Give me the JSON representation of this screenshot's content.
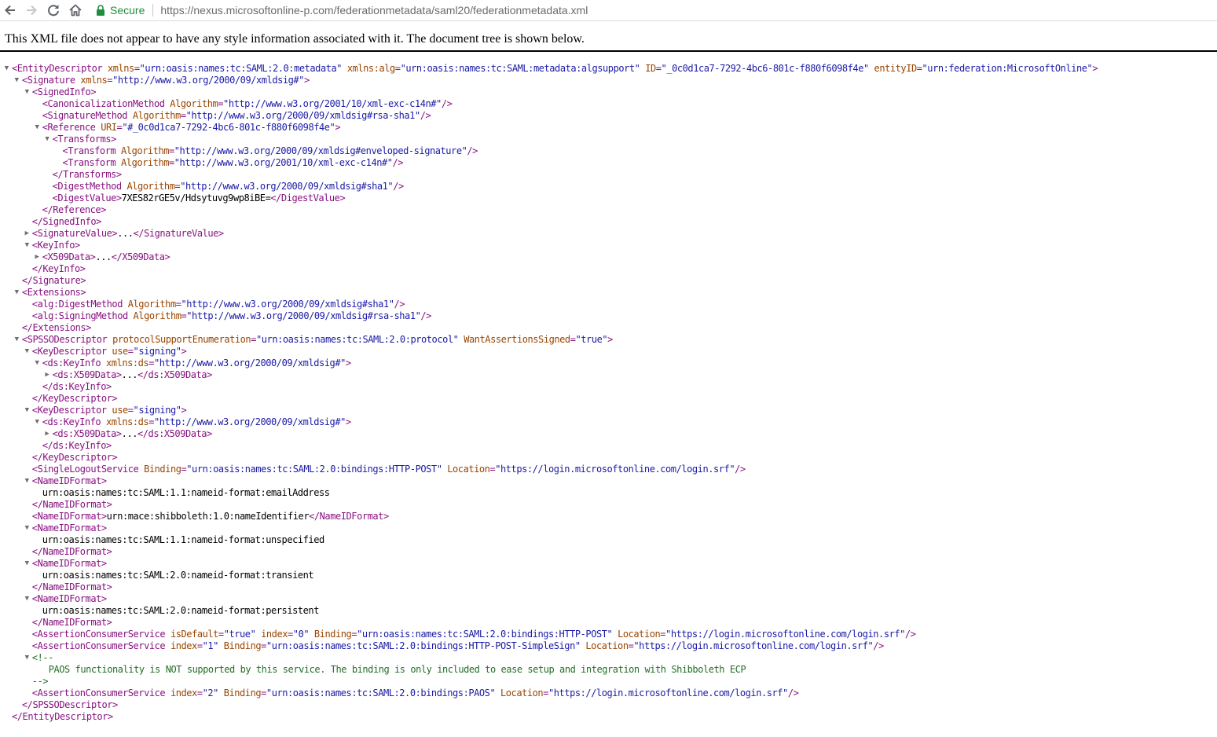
{
  "browser": {
    "secure_label": "Secure",
    "url_scheme": "https://",
    "url_host": "nexus.microsoftonline-p.com",
    "url_path": "/federationmetadata/saml20/federationmetadata.xml"
  },
  "viewer": {
    "info_text": "This XML file does not appear to have any style information associated with it. The document tree is shown below."
  },
  "xml_lines": [
    {
      "i": 0,
      "t": "open",
      "toggle": "expanded",
      "name": "EntityDescriptor",
      "attrs": [
        [
          "xmlns",
          "urn:oasis:names:tc:SAML:2.0:metadata"
        ],
        [
          "xmlns:alg",
          "urn:oasis:names:tc:SAML:metadata:algsupport"
        ],
        [
          "ID",
          "_0c0d1ca7-7292-4bc6-801c-f880f6098f4e"
        ],
        [
          "entityID",
          "urn:federation:MicrosoftOnline"
        ]
      ]
    },
    {
      "i": 1,
      "t": "open",
      "toggle": "expanded",
      "name": "Signature",
      "attrs": [
        [
          "xmlns",
          "http://www.w3.org/2000/09/xmldsig#"
        ]
      ]
    },
    {
      "i": 2,
      "t": "open",
      "toggle": "expanded",
      "name": "SignedInfo",
      "attrs": []
    },
    {
      "i": 3,
      "t": "self",
      "name": "CanonicalizationMethod",
      "attrs": [
        [
          "Algorithm",
          "http://www.w3.org/2001/10/xml-exc-c14n#"
        ]
      ]
    },
    {
      "i": 3,
      "t": "self",
      "name": "SignatureMethod",
      "attrs": [
        [
          "Algorithm",
          "http://www.w3.org/2000/09/xmldsig#rsa-sha1"
        ]
      ]
    },
    {
      "i": 3,
      "t": "open",
      "toggle": "expanded",
      "name": "Reference",
      "attrs": [
        [
          "URI",
          "#_0c0d1ca7-7292-4bc6-801c-f880f6098f4e"
        ]
      ]
    },
    {
      "i": 4,
      "t": "open",
      "toggle": "expanded",
      "name": "Transforms",
      "attrs": []
    },
    {
      "i": 5,
      "t": "self",
      "name": "Transform",
      "attrs": [
        [
          "Algorithm",
          "http://www.w3.org/2000/09/xmldsig#enveloped-signature"
        ]
      ]
    },
    {
      "i": 5,
      "t": "self",
      "name": "Transform",
      "attrs": [
        [
          "Algorithm",
          "http://www.w3.org/2001/10/xml-exc-c14n#"
        ]
      ]
    },
    {
      "i": 4,
      "t": "close",
      "name": "Transforms"
    },
    {
      "i": 4,
      "t": "self",
      "name": "DigestMethod",
      "attrs": [
        [
          "Algorithm",
          "http://www.w3.org/2000/09/xmldsig#sha1"
        ]
      ]
    },
    {
      "i": 4,
      "t": "inline",
      "name": "DigestValue",
      "attrs": [],
      "text": "7XES82rGE5v/Hdsytuvg9wp8iBE="
    },
    {
      "i": 3,
      "t": "close",
      "name": "Reference"
    },
    {
      "i": 2,
      "t": "close",
      "name": "SignedInfo"
    },
    {
      "i": 2,
      "t": "collapsed",
      "toggle": "collapsed",
      "name": "SignatureValue",
      "attrs": [],
      "text": "..."
    },
    {
      "i": 2,
      "t": "open",
      "toggle": "expanded",
      "name": "KeyInfo",
      "attrs": []
    },
    {
      "i": 3,
      "t": "collapsed",
      "toggle": "collapsed",
      "name": "X509Data",
      "attrs": [],
      "text": "..."
    },
    {
      "i": 2,
      "t": "close",
      "name": "KeyInfo"
    },
    {
      "i": 1,
      "t": "close",
      "name": "Signature"
    },
    {
      "i": 1,
      "t": "open",
      "toggle": "expanded",
      "name": "Extensions",
      "attrs": []
    },
    {
      "i": 2,
      "t": "self",
      "name": "alg:DigestMethod",
      "attrs": [
        [
          "Algorithm",
          "http://www.w3.org/2000/09/xmldsig#sha1"
        ]
      ]
    },
    {
      "i": 2,
      "t": "self",
      "name": "alg:SigningMethod",
      "attrs": [
        [
          "Algorithm",
          "http://www.w3.org/2000/09/xmldsig#rsa-sha1"
        ]
      ]
    },
    {
      "i": 1,
      "t": "close",
      "name": "Extensions"
    },
    {
      "i": 1,
      "t": "open",
      "toggle": "expanded",
      "name": "SPSSODescriptor",
      "attrs": [
        [
          "protocolSupportEnumeration",
          "urn:oasis:names:tc:SAML:2.0:protocol"
        ],
        [
          "WantAssertionsSigned",
          "true"
        ]
      ]
    },
    {
      "i": 2,
      "t": "open",
      "toggle": "expanded",
      "name": "KeyDescriptor",
      "attrs": [
        [
          "use",
          "signing"
        ]
      ]
    },
    {
      "i": 3,
      "t": "open",
      "toggle": "expanded",
      "name": "ds:KeyInfo",
      "attrs": [
        [
          "xmlns:ds",
          "http://www.w3.org/2000/09/xmldsig#"
        ]
      ]
    },
    {
      "i": 4,
      "t": "collapsed",
      "toggle": "collapsed",
      "name": "ds:X509Data",
      "attrs": [],
      "text": "..."
    },
    {
      "i": 3,
      "t": "close",
      "name": "ds:KeyInfo"
    },
    {
      "i": 2,
      "t": "close",
      "name": "KeyDescriptor"
    },
    {
      "i": 2,
      "t": "open",
      "toggle": "expanded",
      "name": "KeyDescriptor",
      "attrs": [
        [
          "use",
          "signing"
        ]
      ]
    },
    {
      "i": 3,
      "t": "open",
      "toggle": "expanded",
      "name": "ds:KeyInfo",
      "attrs": [
        [
          "xmlns:ds",
          "http://www.w3.org/2000/09/xmldsig#"
        ]
      ]
    },
    {
      "i": 4,
      "t": "collapsed",
      "toggle": "collapsed",
      "name": "ds:X509Data",
      "attrs": [],
      "text": "..."
    },
    {
      "i": 3,
      "t": "close",
      "name": "ds:KeyInfo"
    },
    {
      "i": 2,
      "t": "close",
      "name": "KeyDescriptor"
    },
    {
      "i": 2,
      "t": "self",
      "name": "SingleLogoutService",
      "attrs": [
        [
          "Binding",
          "urn:oasis:names:tc:SAML:2.0:bindings:HTTP-POST"
        ],
        [
          "Location",
          "https://login.microsoftonline.com/login.srf"
        ]
      ]
    },
    {
      "i": 2,
      "t": "open",
      "toggle": "expanded",
      "name": "NameIDFormat",
      "attrs": []
    },
    {
      "i": 3,
      "t": "text",
      "text": "urn:oasis:names:tc:SAML:1.1:nameid-format:emailAddress"
    },
    {
      "i": 2,
      "t": "close",
      "name": "NameIDFormat"
    },
    {
      "i": 2,
      "t": "inline",
      "name": "NameIDFormat",
      "attrs": [],
      "text": "urn:mace:shibboleth:1.0:nameIdentifier"
    },
    {
      "i": 2,
      "t": "open",
      "toggle": "expanded",
      "name": "NameIDFormat",
      "attrs": []
    },
    {
      "i": 3,
      "t": "text",
      "text": "urn:oasis:names:tc:SAML:1.1:nameid-format:unspecified"
    },
    {
      "i": 2,
      "t": "close",
      "name": "NameIDFormat"
    },
    {
      "i": 2,
      "t": "open",
      "toggle": "expanded",
      "name": "NameIDFormat",
      "attrs": []
    },
    {
      "i": 3,
      "t": "text",
      "text": "urn:oasis:names:tc:SAML:2.0:nameid-format:transient"
    },
    {
      "i": 2,
      "t": "close",
      "name": "NameIDFormat"
    },
    {
      "i": 2,
      "t": "open",
      "toggle": "expanded",
      "name": "NameIDFormat",
      "attrs": []
    },
    {
      "i": 3,
      "t": "text",
      "text": "urn:oasis:names:tc:SAML:2.0:nameid-format:persistent"
    },
    {
      "i": 2,
      "t": "close",
      "name": "NameIDFormat"
    },
    {
      "i": 2,
      "t": "self",
      "name": "AssertionConsumerService",
      "attrs": [
        [
          "isDefault",
          "true"
        ],
        [
          "index",
          "0"
        ],
        [
          "Binding",
          "urn:oasis:names:tc:SAML:2.0:bindings:HTTP-POST"
        ],
        [
          "Location",
          "https://login.microsoftonline.com/login.srf"
        ]
      ]
    },
    {
      "i": 2,
      "t": "self",
      "name": "AssertionConsumerService",
      "attrs": [
        [
          "index",
          "1"
        ],
        [
          "Binding",
          "urn:oasis:names:tc:SAML:2.0:bindings:HTTP-POST-SimpleSign"
        ],
        [
          "Location",
          "https://login.microsoftonline.com/login.srf"
        ]
      ]
    },
    {
      "i": 2,
      "t": "comment-open",
      "toggle": "expanded",
      "text": "<!--"
    },
    {
      "i": 3,
      "t": "comment-body",
      "text": "PAOS functionality is NOT supported by this service. The binding is only included to ease setup and integration with Shibboleth ECP"
    },
    {
      "i": 2,
      "t": "comment-close",
      "text": "-->"
    },
    {
      "i": 2,
      "t": "self",
      "name": "AssertionConsumerService",
      "attrs": [
        [
          "index",
          "2"
        ],
        [
          "Binding",
          "urn:oasis:names:tc:SAML:2.0:bindings:PAOS"
        ],
        [
          "Location",
          "https://login.microsoftonline.com/login.srf"
        ]
      ]
    },
    {
      "i": 1,
      "t": "close",
      "name": "SPSSODescriptor"
    },
    {
      "i": 0,
      "t": "close",
      "name": "EntityDescriptor"
    }
  ]
}
